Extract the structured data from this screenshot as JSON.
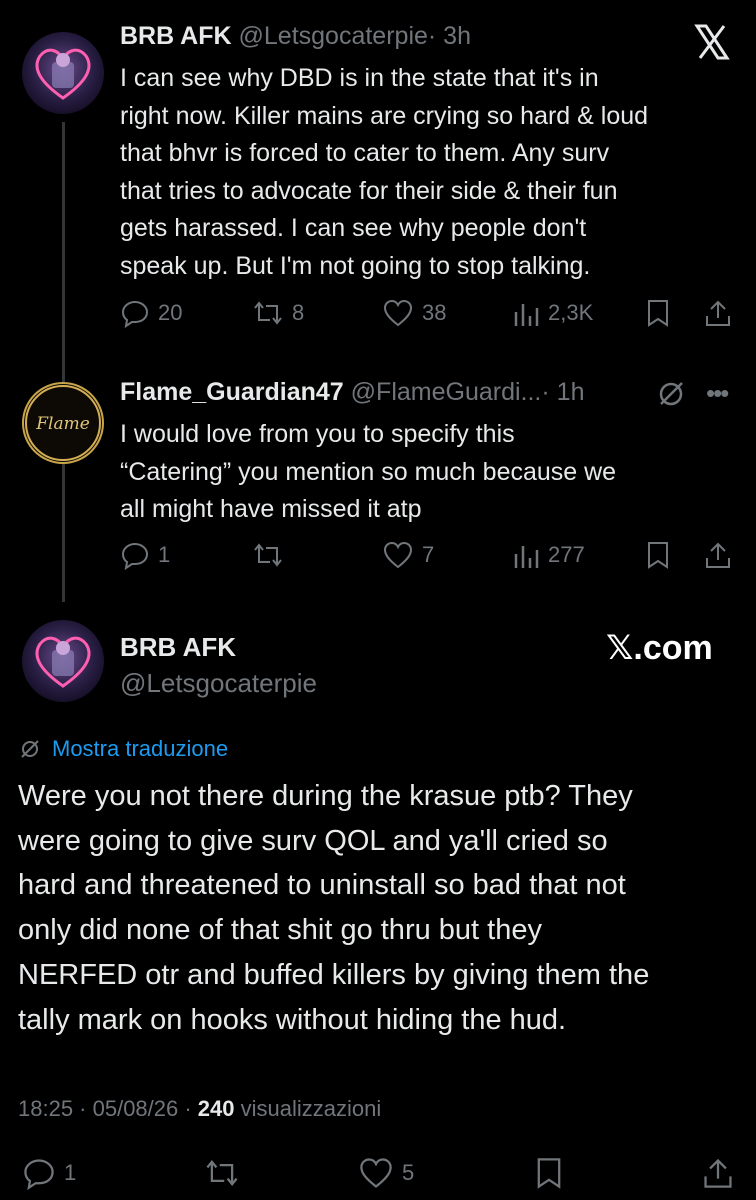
{
  "brand_color": "#000000",
  "text_color": "#e7e9ea",
  "muted_color": "#71767b",
  "link_color": "#1d9bf0",
  "tweet1": {
    "name": "BRB AFK",
    "handle": "@Letsgocaterpie",
    "time": "· 3h",
    "text_lines": [
      "I can see why DBD is in the state that it's in",
      "right now. Killer mains are crying so hard & loud",
      "that bhvr is forced to cater to them. Any surv",
      "that tries to advocate for their side & their fun",
      "gets harassed. I can see why people don't",
      "speak up. But I'm not going to stop talking."
    ],
    "replies": "20",
    "reposts": "8",
    "likes": "38",
    "views": "2,3K",
    "logo_icon": "x-logo-icon"
  },
  "tweet2": {
    "name": "Flame_Guardian47",
    "handle": "@FlameGuardi...",
    "time": "· 1h",
    "avatar_text": "Flame",
    "text_lines": [
      "I would love from you to specify this",
      "“Catering” you mention so much because we",
      "all might have missed it atp"
    ],
    "replies": "1",
    "reposts": "",
    "likes": "7",
    "views": "277"
  },
  "main_tweet": {
    "name": "BRB AFK",
    "handle": "@Letsgocaterpie",
    "brand_label": "𝕏.com",
    "translate_label": "Mostra traduzione",
    "text_lines": [
      "Were you not there during the krasue ptb? They",
      "were going to give surv QOL and ya'll cried so",
      "hard and threatened to uninstall so bad that not",
      "only did none of that shit go thru but they",
      "NERFED otr and buffed killers by giving them the",
      "tally mark on hooks without hiding the hud."
    ],
    "timestamp": "18:25 · 05/08/26 · ",
    "views_count": "240",
    "views_label": " visualizzazioni",
    "replies": "1",
    "reposts": "",
    "likes": "5"
  }
}
